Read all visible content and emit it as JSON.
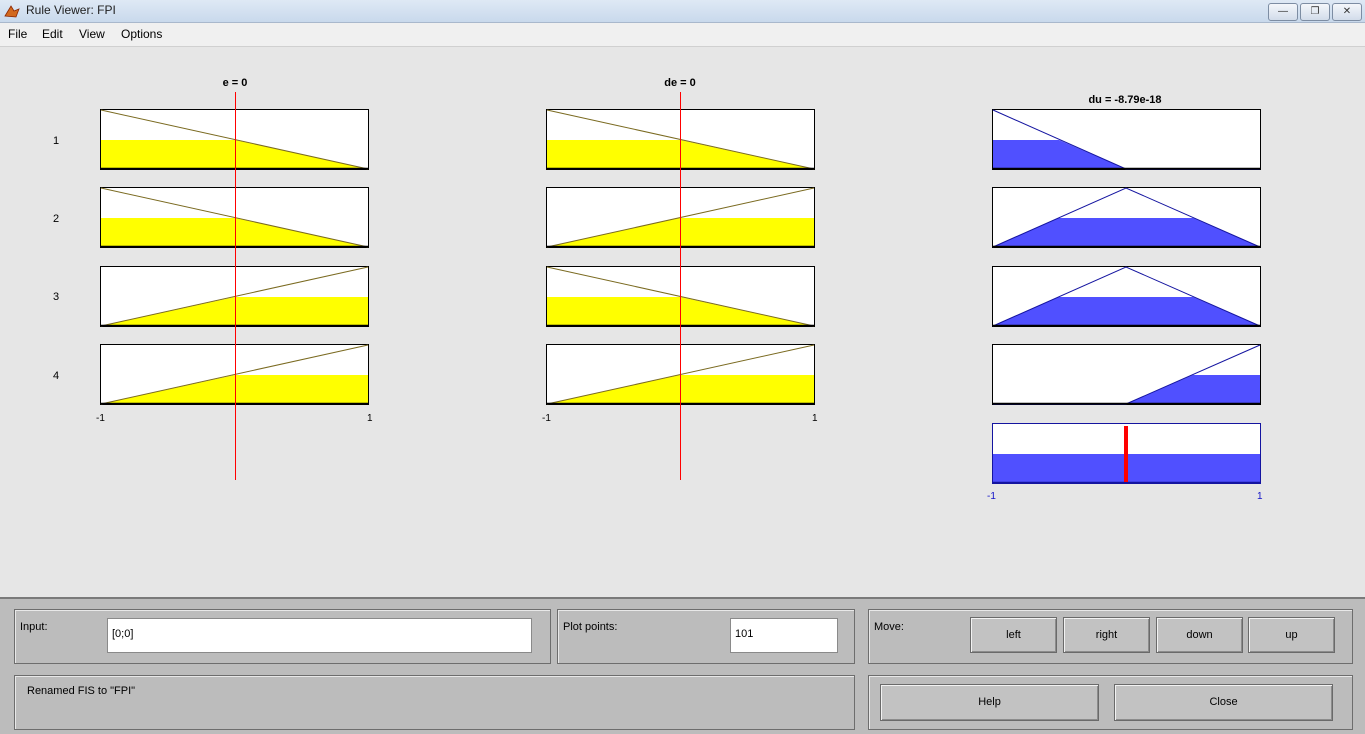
{
  "window": {
    "title": "Rule Viewer: FPI"
  },
  "menu": {
    "items": [
      "File",
      "Edit",
      "View",
      "Options"
    ]
  },
  "inputs": [
    {
      "title": "e = 0",
      "tick_min": "-1",
      "tick_max": "1"
    },
    {
      "title": "de = 0",
      "tick_min": "-1",
      "tick_max": "1"
    }
  ],
  "output": {
    "title": "du = -8.79e-18",
    "tick_min": "-1",
    "tick_max": "1"
  },
  "rules": [
    "1",
    "2",
    "3",
    "4"
  ],
  "colors": {
    "input_fill": "#ffff00",
    "output_fill": "#5050ff",
    "indicator": "#ff0000"
  },
  "controls": {
    "input_label": "Input:",
    "input_value": "[0;0]",
    "plot_points_label": "Plot points:",
    "plot_points_value": "101",
    "move_label": "Move:",
    "move_buttons": [
      "left",
      "right",
      "down",
      "up"
    ],
    "status": "Renamed FIS to \"FPI\"",
    "help_label": "Help",
    "close_label": "Close"
  }
}
